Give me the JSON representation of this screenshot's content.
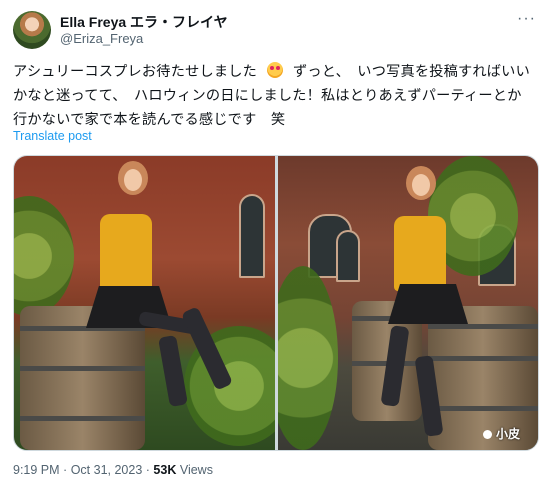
{
  "tweet": {
    "author_name": "Ella Freya エラ・フレイヤ",
    "author_handle": "@Eriza_Freya",
    "text_part1": "アシュリーコスプレお待たせしました",
    "text_part2": "ずっと、　いつ写真を投稿すればいいかなと迷ってて、　ハロウィンの日にしました！私はとりあえずパーティーとか行かないで家で本を読んでる感じです　笑",
    "emoji_icon": "star-struck-emoji-icon",
    "translate_label": "Translate post",
    "more_icon": "···",
    "media": {
      "watermark": "小皮"
    },
    "meta": {
      "time": "9:19 PM",
      "separator": "·",
      "date": "Oct 31, 2023",
      "views_count": "53K",
      "views_label": "Views"
    }
  },
  "colors": {
    "link": "#1d9bf0",
    "secondary_text": "#536471",
    "primary_text": "#0f1419",
    "border": "#cfd9de"
  }
}
